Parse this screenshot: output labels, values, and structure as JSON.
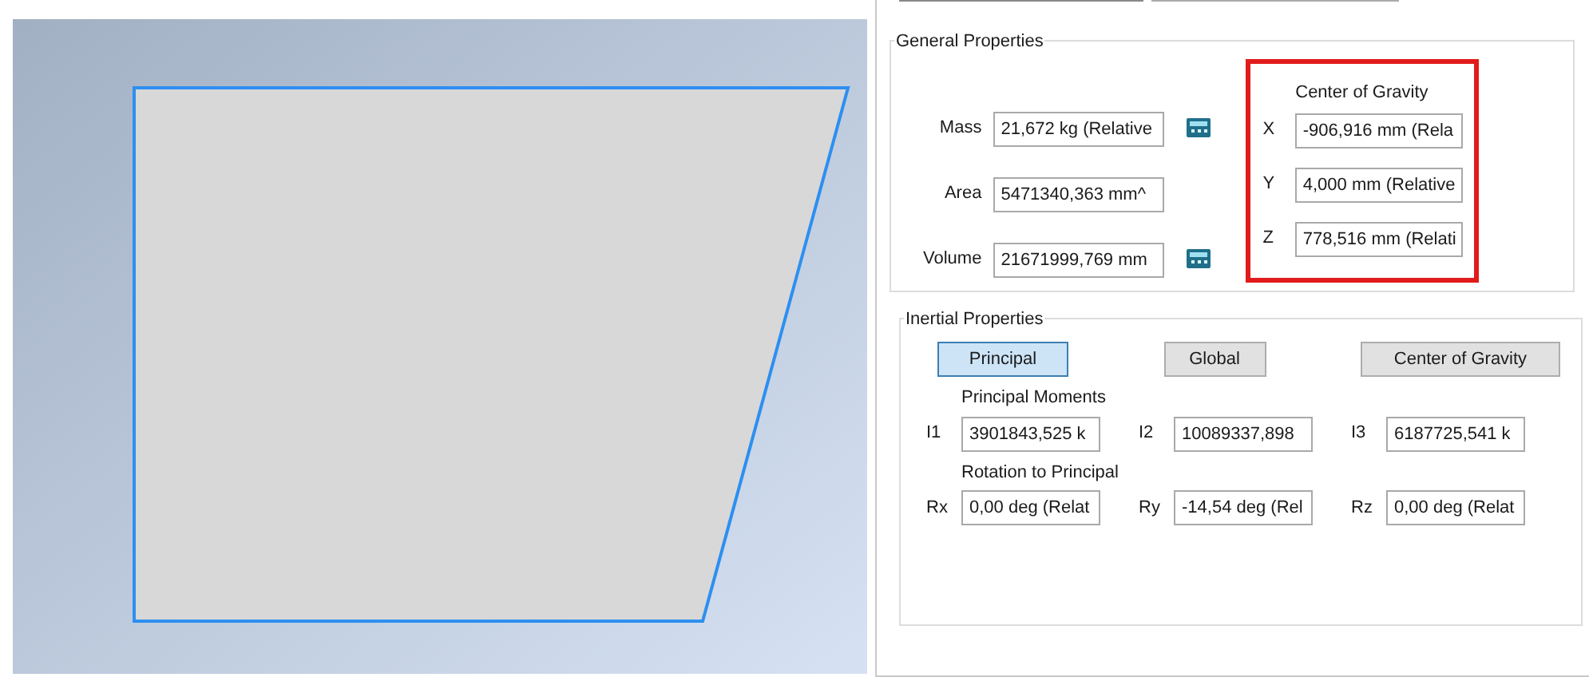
{
  "general_properties": {
    "title": "General Properties",
    "fields": [
      {
        "label": "Mass",
        "value": "21,672 kg (Relative",
        "calculator": true
      },
      {
        "label": "Area",
        "value": "5471340,363 mm^",
        "calculator": false
      },
      {
        "label": "Volume",
        "value": "21671999,769 mm",
        "calculator": true
      }
    ],
    "center_of_gravity": {
      "title": "Center of Gravity",
      "highlighted": true,
      "fields": [
        {
          "label": "X",
          "value": "-906,916 mm (Rela"
        },
        {
          "label": "Y",
          "value": "4,000 mm (Relative"
        },
        {
          "label": "Z",
          "value": "778,516 mm (Relati"
        }
      ]
    }
  },
  "inertial_properties": {
    "title": "Inertial Properties",
    "buttons": [
      {
        "label": "Principal",
        "selected": true
      },
      {
        "label": "Global",
        "selected": false
      },
      {
        "label": "Center of Gravity",
        "selected": false
      }
    ],
    "principal_moments": {
      "title": "Principal Moments",
      "fields": [
        {
          "label": "I1",
          "value": "3901843,525 k"
        },
        {
          "label": "I2",
          "value": "10089337,898"
        },
        {
          "label": "I3",
          "value": "6187725,541 k"
        }
      ]
    },
    "rotation_to_principal": {
      "title": "Rotation to Principal",
      "fields": [
        {
          "label": "Rx",
          "value": "0,00 deg (Relat"
        },
        {
          "label": "Ry",
          "value": "-14,54 deg (Rel"
        },
        {
          "label": "Rz",
          "value": "0,00 deg (Relat"
        }
      ]
    }
  }
}
